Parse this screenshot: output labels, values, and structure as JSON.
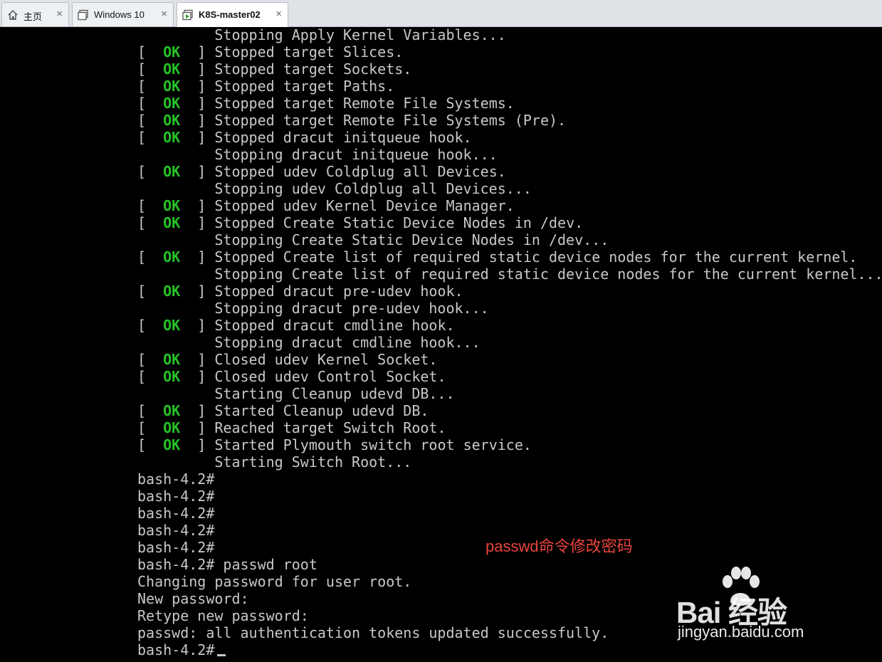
{
  "tabs": [
    {
      "label": "主页",
      "icon": "home-icon",
      "active": false
    },
    {
      "label": "Windows 10",
      "icon": "vm-window-icon",
      "active": false
    },
    {
      "label": "K8S-master02",
      "icon": "vm-running-icon",
      "active": true
    }
  ],
  "close_glyph": "×",
  "console": {
    "lines": [
      {
        "kind": "plain",
        "text": "         Stopping Apply Kernel Variables..."
      },
      {
        "kind": "ok",
        "text": "Stopped target Slices."
      },
      {
        "kind": "ok",
        "text": "Stopped target Sockets."
      },
      {
        "kind": "ok",
        "text": "Stopped target Paths."
      },
      {
        "kind": "ok",
        "text": "Stopped target Remote File Systems."
      },
      {
        "kind": "ok",
        "text": "Stopped target Remote File Systems (Pre)."
      },
      {
        "kind": "ok",
        "text": "Stopped dracut initqueue hook."
      },
      {
        "kind": "plain",
        "text": "         Stopping dracut initqueue hook..."
      },
      {
        "kind": "ok",
        "text": "Stopped udev Coldplug all Devices."
      },
      {
        "kind": "plain",
        "text": "         Stopping udev Coldplug all Devices..."
      },
      {
        "kind": "ok",
        "text": "Stopped udev Kernel Device Manager."
      },
      {
        "kind": "ok",
        "text": "Stopped Create Static Device Nodes in /dev."
      },
      {
        "kind": "plain",
        "text": "         Stopping Create Static Device Nodes in /dev..."
      },
      {
        "kind": "ok",
        "text": "Stopped Create list of required static device nodes for the current kernel."
      },
      {
        "kind": "plain",
        "text": "         Stopping Create list of required static device nodes for the current kernel..."
      },
      {
        "kind": "ok",
        "text": "Stopped dracut pre-udev hook."
      },
      {
        "kind": "plain",
        "text": "         Stopping dracut pre-udev hook..."
      },
      {
        "kind": "ok",
        "text": "Stopped dracut cmdline hook."
      },
      {
        "kind": "plain",
        "text": "         Stopping dracut cmdline hook..."
      },
      {
        "kind": "ok",
        "text": "Closed udev Kernel Socket."
      },
      {
        "kind": "ok",
        "text": "Closed udev Control Socket."
      },
      {
        "kind": "plain",
        "text": "         Starting Cleanup udevd DB..."
      },
      {
        "kind": "ok",
        "text": "Started Cleanup udevd DB."
      },
      {
        "kind": "ok",
        "text": "Reached target Switch Root."
      },
      {
        "kind": "ok",
        "text": "Started Plymouth switch root service."
      },
      {
        "kind": "plain",
        "text": "         Starting Switch Root..."
      },
      {
        "kind": "plain",
        "text": "bash-4.2#"
      },
      {
        "kind": "plain",
        "text": "bash-4.2#"
      },
      {
        "kind": "plain",
        "text": "bash-4.2#"
      },
      {
        "kind": "plain",
        "text": "bash-4.2#"
      },
      {
        "kind": "plain",
        "text": "bash-4.2#"
      },
      {
        "kind": "plain",
        "text": "bash-4.2# passwd root"
      },
      {
        "kind": "plain",
        "text": "Changing password for user root."
      },
      {
        "kind": "plain",
        "text": "New password:"
      },
      {
        "kind": "plain",
        "text": "Retype new password:"
      },
      {
        "kind": "plain",
        "text": "passwd: all authentication tokens updated successfully."
      },
      {
        "kind": "prompt",
        "text": "bash-4.2#"
      }
    ],
    "ok_label": "OK",
    "bracket_open": "[",
    "bracket_close": "]"
  },
  "annotation": "passwd命令修改密码",
  "watermark": {
    "logo": "Bai  经验",
    "url": "jingyan.baidu.com"
  },
  "colors": {
    "ok": "#27c227",
    "text": "#c8c8c8",
    "annotation": "#e8453c"
  }
}
